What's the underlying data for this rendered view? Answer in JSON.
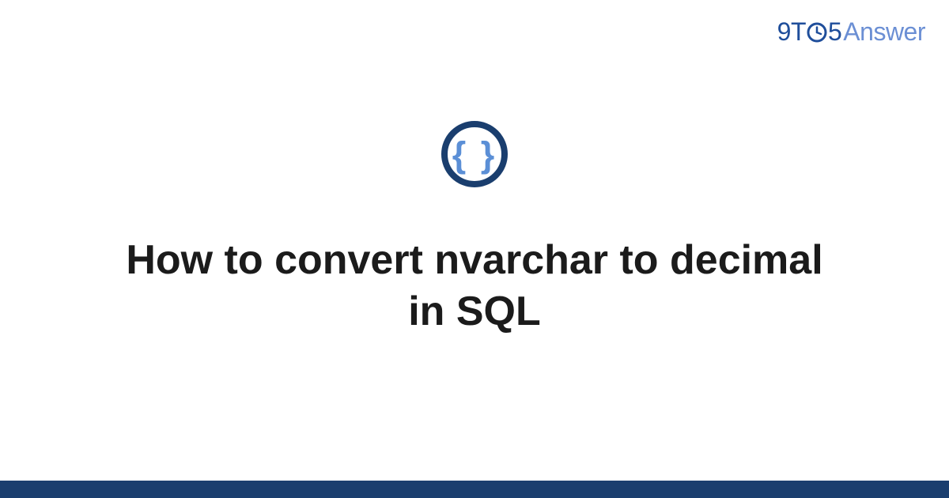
{
  "brand": {
    "part1": "9T",
    "clock_icon": "clock-o",
    "part2": "5",
    "part3": "Answer"
  },
  "main": {
    "icon": "code-braces-icon",
    "braces_glyph": "{ }",
    "title": "How to convert nvarchar to decimal in SQL"
  },
  "colors": {
    "brand_primary": "#1f4e9b",
    "brand_secondary": "#6b8fd4",
    "icon_ring": "#1a3e6e",
    "icon_braces": "#5b8fd6",
    "footer": "#1a3e6e"
  }
}
